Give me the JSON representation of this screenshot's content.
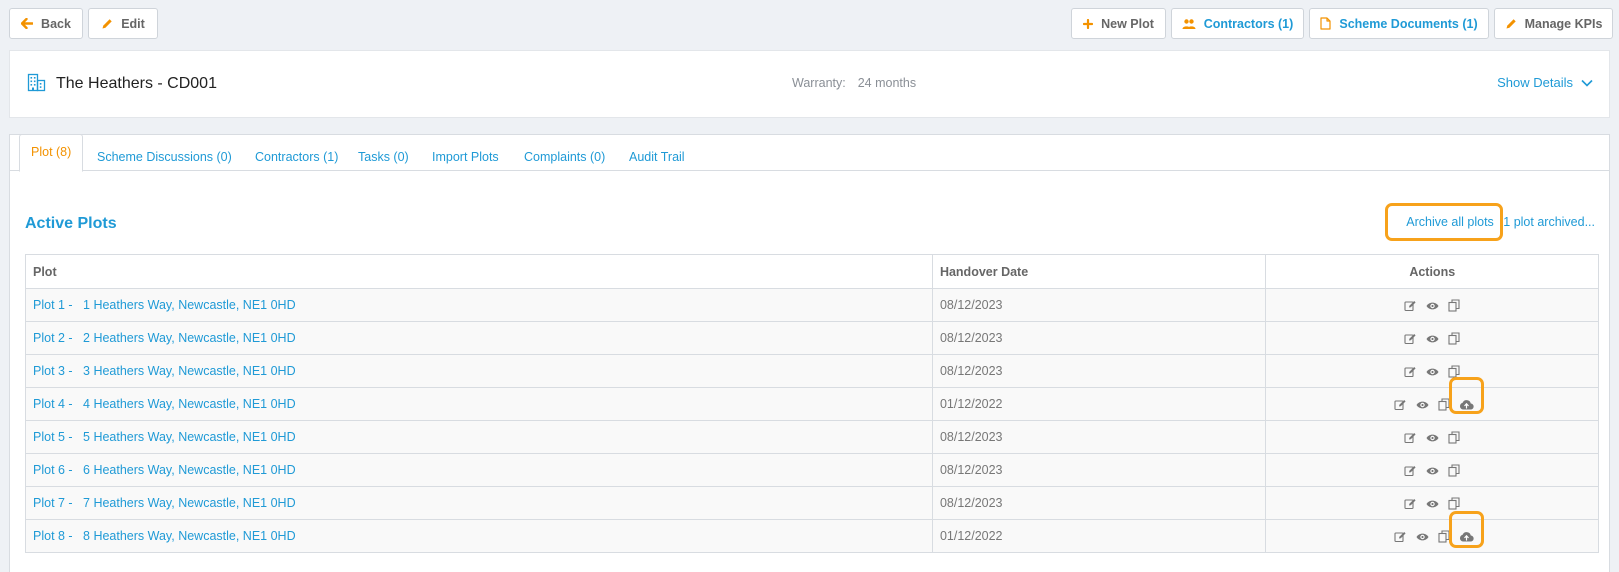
{
  "toolbar": {
    "back_label": "Back",
    "edit_label": "Edit",
    "new_plot_label": "New Plot",
    "contractors_label": "Contractors (1)",
    "scheme_docs_label": "Scheme Documents (1)",
    "manage_kpis_label": "Manage KPIs"
  },
  "header": {
    "title": "The Heathers - CD001",
    "warranty_label": "Warranty:",
    "warranty_value": "24 months",
    "show_details_label": "Show Details"
  },
  "tabs": [
    {
      "label": "Plot (8)"
    },
    {
      "label": "Scheme Discussions (0)"
    },
    {
      "label": "Contractors (1)"
    },
    {
      "label": "Tasks (0)"
    },
    {
      "label": "Import Plots"
    },
    {
      "label": "Complaints (0)"
    },
    {
      "label": "Audit Trail"
    }
  ],
  "section": {
    "title": "Active Plots",
    "archive_all_label": "Archive all plots",
    "archived_link": "1 plot archived..."
  },
  "table": {
    "headers": {
      "plot": "Plot",
      "handover": "Handover Date",
      "actions": "Actions"
    },
    "rows": [
      {
        "plot": "Plot 1 -   1 Heathers Way, Newcastle, NE1 0HD",
        "date": "08/12/2023"
      },
      {
        "plot": "Plot 2 -   2 Heathers Way, Newcastle, NE1 0HD",
        "date": "08/12/2023"
      },
      {
        "plot": "Plot 3 -   3 Heathers Way, Newcastle, NE1 0HD",
        "date": "08/12/2023"
      },
      {
        "plot": "Plot 4 -   4 Heathers Way, Newcastle, NE1 0HD",
        "date": "01/12/2022"
      },
      {
        "plot": "Plot 5 -   5 Heathers Way, Newcastle, NE1 0HD",
        "date": "08/12/2023"
      },
      {
        "plot": "Plot 6 -   6 Heathers Way, Newcastle, NE1 0HD",
        "date": "08/12/2023"
      },
      {
        "plot": "Plot 7 -   7 Heathers Way, Newcastle, NE1 0HD",
        "date": "08/12/2023"
      },
      {
        "plot": "Plot 8 -   8 Heathers Way, Newcastle, NE1 0HD",
        "date": "01/12/2022"
      }
    ]
  },
  "colors": {
    "accent_blue": "#1f9ad6",
    "accent_orange": "#f39200",
    "highlight": "#f7a21b"
  },
  "icons": [
    "arrow-left-icon",
    "pencil-icon",
    "plus-icon",
    "users-icon",
    "document-icon",
    "building-icon",
    "chevron-down-icon",
    "edit-icon",
    "eye-icon",
    "copy-icon",
    "cloud-upload-icon"
  ]
}
